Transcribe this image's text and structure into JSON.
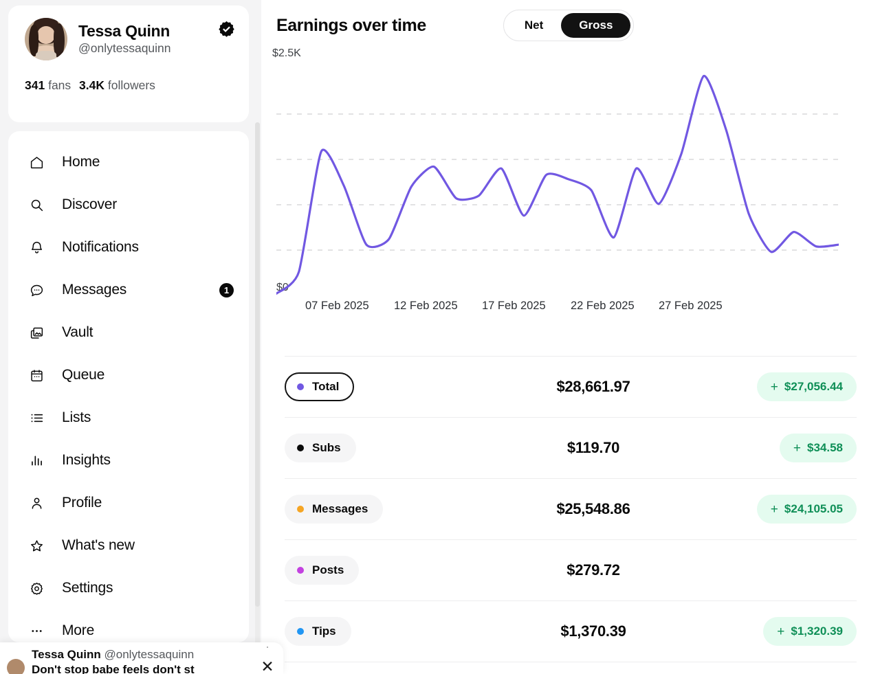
{
  "profile": {
    "display_name": "Tessa Quinn",
    "handle": "@onlytessaquinn",
    "verified_icon": "verified-badge-icon",
    "fans_count": "341",
    "fans_label": "fans",
    "followers_count": "3.4K",
    "followers_label": "followers"
  },
  "sidebar": {
    "items": [
      {
        "label": "Home",
        "icon": "home-icon"
      },
      {
        "label": "Discover",
        "icon": "search-icon"
      },
      {
        "label": "Notifications",
        "icon": "bell-icon"
      },
      {
        "label": "Messages",
        "icon": "chat-bubble-icon",
        "badge": "1"
      },
      {
        "label": "Vault",
        "icon": "image-stack-icon"
      },
      {
        "label": "Queue",
        "icon": "calendar-icon"
      },
      {
        "label": "Lists",
        "icon": "list-icon"
      },
      {
        "label": "Insights",
        "icon": "bar-chart-icon"
      },
      {
        "label": "Profile",
        "icon": "person-icon"
      },
      {
        "label": "What's new",
        "icon": "star-icon"
      },
      {
        "label": "Settings",
        "icon": "gear-icon"
      },
      {
        "label": "More",
        "icon": "ellipsis-icon"
      }
    ]
  },
  "chart_panel": {
    "title": "Earnings over time",
    "toggle": {
      "options": [
        "Net",
        "Gross"
      ],
      "selected": "Gross"
    }
  },
  "chart_data": {
    "type": "line",
    "title": "Earnings over time",
    "xlabel": "",
    "ylabel": "",
    "ylim": [
      0,
      2500
    ],
    "ytick_labels": [
      "$0",
      "$2.5K"
    ],
    "grid": true,
    "gridlines": [
      500,
      1000,
      1500,
      2000
    ],
    "legend_position": "below-chart",
    "line_color": "#7158e2",
    "xtick_labels": [
      "07 Feb 2025",
      "12 Feb 2025",
      "17 Feb 2025",
      "22 Feb 2025",
      "27 Feb 2025"
    ],
    "x": [
      "2025-02-05",
      "2025-02-06",
      "2025-02-07",
      "2025-02-08",
      "2025-02-09",
      "2025-02-10",
      "2025-02-11",
      "2025-02-12",
      "2025-02-13",
      "2025-02-14",
      "2025-02-15",
      "2025-02-16",
      "2025-02-17",
      "2025-02-18",
      "2025-02-19",
      "2025-02-20",
      "2025-02-21",
      "2025-02-22",
      "2025-02-23",
      "2025-02-24",
      "2025-02-25",
      "2025-02-26",
      "2025-02-27",
      "2025-02-28",
      "2025-03-01",
      "2025-03-02"
    ],
    "series": [
      {
        "name": "Total",
        "color": "#7158e2",
        "values": [
          20,
          260,
          1590,
          1210,
          560,
          620,
          1200,
          1420,
          1070,
          1100,
          1400,
          880,
          1330,
          1280,
          1160,
          640,
          1400,
          1010,
          1560,
          2420,
          1820,
          900,
          480,
          700,
          540,
          560
        ]
      }
    ]
  },
  "breakdown": {
    "rows": [
      {
        "label": "Total",
        "dot_color": "#7158e2",
        "amount": "$28,661.97",
        "delta": "$27,056.44",
        "delta_sign": "+",
        "selected": true
      },
      {
        "label": "Subs",
        "dot_color": "#0a0a0a",
        "amount": "$119.70",
        "delta": "$34.58",
        "delta_sign": "+",
        "selected": false
      },
      {
        "label": "Messages",
        "dot_color": "#f5a524",
        "amount": "$25,548.86",
        "delta": "$24,105.05",
        "delta_sign": "+",
        "selected": false
      },
      {
        "label": "Posts",
        "dot_color": "#c341e0",
        "amount": "$279.72",
        "delta": null,
        "delta_sign": "+",
        "selected": false
      },
      {
        "label": "Tips",
        "dot_color": "#2196f3",
        "amount": "$1,370.39",
        "delta": "$1,320.39",
        "delta_sign": "+",
        "selected": false
      }
    ]
  },
  "toast": {
    "name": "Tessa Quinn",
    "handle": "@onlytessaquinn",
    "message": "Don't stop babe feels don't st",
    "close_icon": "close-icon"
  },
  "colors": {
    "accent_purple": "#7158e2",
    "positive_green": "#0f8f57",
    "positive_green_bg": "#e4fbef",
    "page_bg": "#f4f4f5",
    "ink": "#0a0a0a"
  }
}
